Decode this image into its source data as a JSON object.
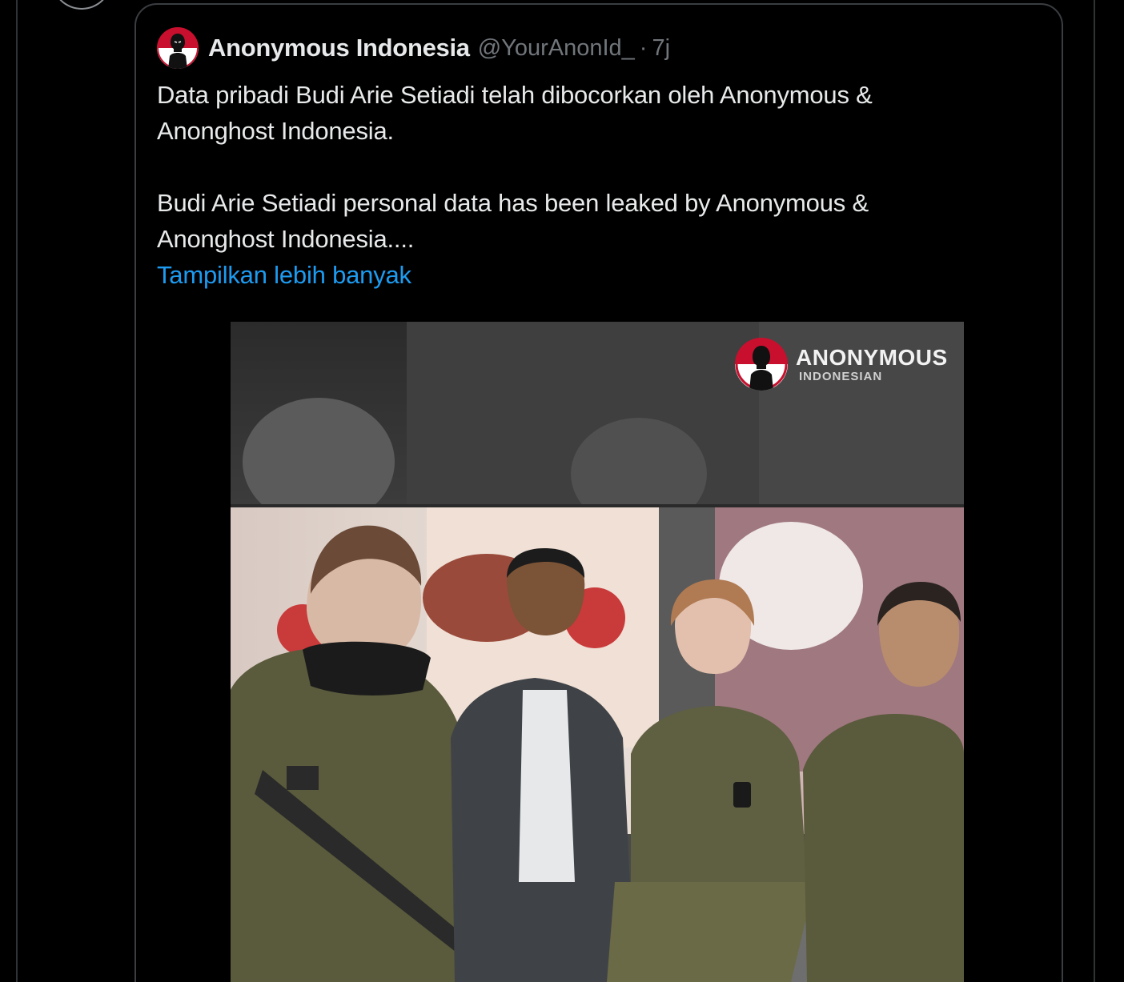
{
  "colors": {
    "background": "#000000",
    "text": "#e7e9ea",
    "secondary_text": "#71767b",
    "link": "#1d9bf0",
    "border": "#3a3d41",
    "brand_red": "#c8102e"
  },
  "quoted_tweet": {
    "author": {
      "display_name": "Anonymous Indonesia",
      "handle": "@YourAnonId_",
      "separator": "·",
      "age": "7j",
      "avatar_icon": "anonymous-mask-red-white-logo"
    },
    "text_lines": {
      "id_line_1": "Data pribadi Budi Arie Setiadi telah dibocorkan oleh Anonymous &",
      "id_line_2": "Anonghost Indonesia.",
      "en_line_1": "Budi Arie Setiadi personal data has been leaked by Anonymous &",
      "en_line_2": "Anonghost Indonesia...."
    },
    "show_more_label": "Tampilkan lebih banyak",
    "media": {
      "type": "photo",
      "watermark_title": "ANONYMOUS",
      "watermark_subtitle": "INDONESIAN"
    }
  }
}
